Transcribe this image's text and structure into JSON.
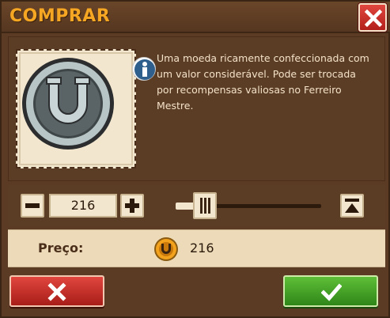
{
  "dialog": {
    "title": "COMPRAR",
    "close_icon": "close-icon"
  },
  "item": {
    "name_icon": "horseshoe-coin-icon",
    "info_icon": "info-icon",
    "description": "Uma moeda ricamente confeccionada com um valor considerável. Pode ser trocada por recompensas valiosas no Ferreiro Mestre."
  },
  "quantity": {
    "value": "216",
    "minus_icon": "minus-icon",
    "plus_icon": "plus-icon",
    "max_icon": "max-icon",
    "slider_fraction": 0.2
  },
  "price": {
    "label": "Preço:",
    "currency_icon": "horseshoe-coin-icon",
    "value": "216"
  },
  "actions": {
    "cancel_icon": "close-icon",
    "confirm_icon": "check-icon"
  },
  "colors": {
    "title": "#f5a623",
    "panel": "#5b3c25",
    "cancel": "#c82a22",
    "confirm": "#3fa01f"
  }
}
